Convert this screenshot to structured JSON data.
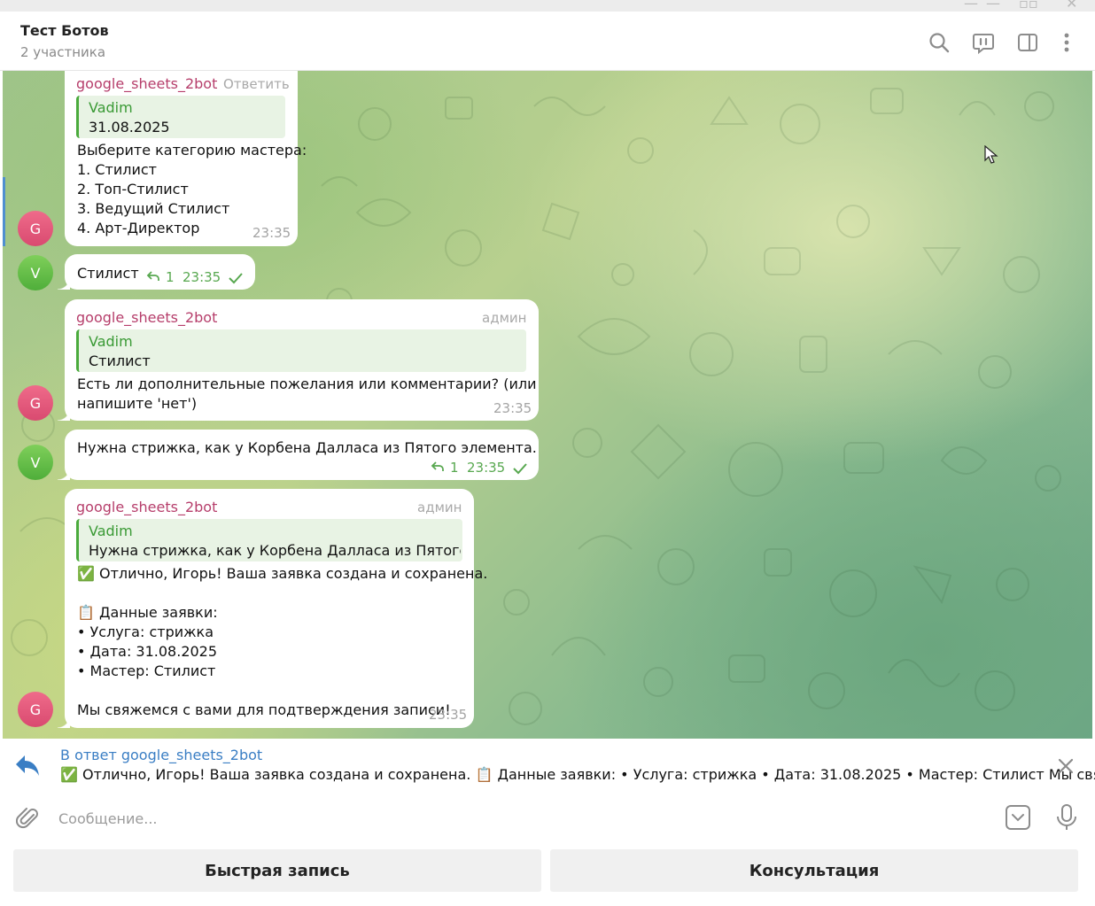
{
  "header": {
    "title": "Тест Ботов",
    "subtitle": "2 участника",
    "icons": [
      "search-icon",
      "video-chat-icon",
      "sidebar-toggle-icon",
      "more-vertical-icon"
    ]
  },
  "messages": [
    {
      "sender": "google_sheets_2bot",
      "action": "Ответить",
      "quote": {
        "name": "Vadim",
        "text": "31.08.2025"
      },
      "lines": [
        "Выберите категорию мастера:",
        "1. Стилист",
        "2. Топ-Стилист",
        "3. Ведущий Стилист",
        "4. Арт-Директор"
      ],
      "time": "23:35",
      "avatar": "G"
    },
    {
      "text": "Стилист",
      "replies": "1",
      "time": "23:35",
      "avatar": "V"
    },
    {
      "sender": "google_sheets_2bot",
      "badge": "админ",
      "quote": {
        "name": "Vadim",
        "text": "Стилист"
      },
      "lines": [
        "Есть ли дополнительные пожелания или комментарии? (или",
        "напишите 'нет')"
      ],
      "time": "23:35",
      "avatar": "G"
    },
    {
      "text": "Нужна стрижка, как у Корбена Далласа из Пятого элемента.",
      "replies": "1",
      "time": "23:35",
      "avatar": "V"
    },
    {
      "sender": "google_sheets_2bot",
      "badge": "админ",
      "quote": {
        "name": "Vadim",
        "text": "Нужна стрижка, как у Корбена Далласа из Пятого э..."
      },
      "lines": [
        "✅ Отлично, Игорь! Ваша заявка создана и сохранена.",
        "",
        "📋 Данные заявки:",
        "• Услуга: стрижка",
        "• Дата: 31.08.2025",
        "• Мастер: Стилист",
        "",
        "Мы свяжемся с вами для подтверждения записи!"
      ],
      "time": "23:35",
      "avatar": "G"
    }
  ],
  "reply_bar": {
    "title": "В ответ google_sheets_2bot",
    "text": "✅ Отлично, Игорь! Ваша заявка создана и сохранена.  📋 Данные заявки: • Услуга: стрижка • Дата: 31.08.2025 • Мастер: Стилист  Мы свяж..."
  },
  "composer": {
    "placeholder": "Сообщение...",
    "value": ""
  },
  "keyboard": {
    "buttons": [
      "Быстрая запись",
      "Консультация"
    ]
  },
  "colors": {
    "sender": "#b63e6b",
    "quote_accent": "#4aaa3c",
    "link": "#3a7ec4",
    "avatar_g": "#e55a7d",
    "avatar_v": "#62be47"
  }
}
